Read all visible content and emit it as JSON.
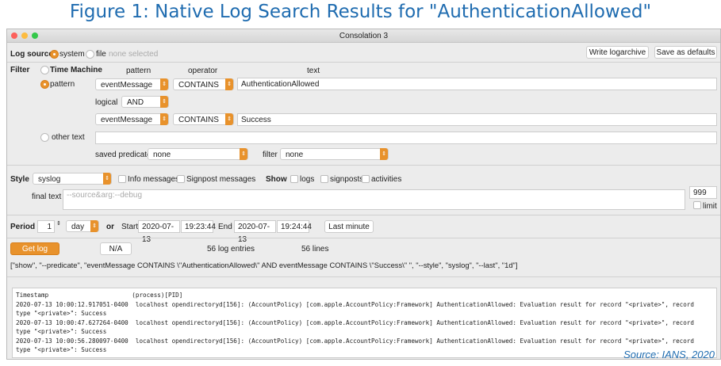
{
  "figure_title": "Figure 1: Native Log Search Results for \"AuthenticationAllowed\"",
  "window_title": "Consolation 3",
  "log_source": {
    "label": "Log source",
    "system": "system",
    "file": "file",
    "file_value": "none selected",
    "write_button": "Write logarchive",
    "save_button": "Save as defaults"
  },
  "filter": {
    "label": "Filter",
    "time_machine": "Time Machine",
    "col_pattern": "pattern",
    "col_operator": "operator",
    "col_text": "text",
    "pattern_radio": "pattern",
    "row1": {
      "field": "eventMessage",
      "operator": "CONTAINS",
      "text": "AuthenticationAllowed"
    },
    "logical_label": "logical",
    "logical": "AND",
    "row2": {
      "field": "eventMessage",
      "operator": "CONTAINS",
      "text": "Success"
    },
    "other_text": "other text",
    "saved_predicate_label": "saved predicate",
    "saved_predicate": "none",
    "filter_label": "filter",
    "filter_value": "none"
  },
  "style": {
    "label": "Style",
    "value": "syslog",
    "info": "Info messages",
    "signpost": "Signpost messages",
    "show": "Show",
    "logs": "logs",
    "signposts": "signposts",
    "activities": "activities",
    "final_text_label": "final text",
    "final_text_placeholder": "--source&arg:--debug",
    "limit_value": "999",
    "limit": "limit"
  },
  "period": {
    "label": "Period",
    "count": "1",
    "unit": "day",
    "or": "or",
    "start_label": "Start",
    "start_date": "2020-07-13",
    "start_time": "19:23:44",
    "end_label": "End",
    "end_date": "2020-07-13",
    "end_time": "19:24:44",
    "last_minute": "Last minute"
  },
  "actions": {
    "get_log": "Get log",
    "na": "N/A",
    "entries": "56 log entries",
    "lines": "56 lines"
  },
  "command": "[\"show\", \"--predicate\", \"eventMessage CONTAINS \\\"AuthenticationAllowed\\\" AND eventMessage CONTAINS \\\"Success\\\" \", \"--style\", \"syslog\", \"--last\", \"1d\"]",
  "log_lines": [
    "Timestamp                       (process)[PID]",
    "2020-07-13 10:00:12.917051-0400  localhost opendirectoryd[156]: (AccountPolicy) [com.apple.AccountPolicy:Framework] AuthenticationAllowed: Evaluation result for record \"<private>\", record",
    "type \"<private>\": Success",
    "2020-07-13 10:00:47.627264-0400  localhost opendirectoryd[156]: (AccountPolicy) [com.apple.AccountPolicy:Framework] AuthenticationAllowed: Evaluation result for record \"<private>\", record",
    "type \"<private>\": Success",
    "2020-07-13 10:00:56.280097-0400  localhost opendirectoryd[156]: (AccountPolicy) [com.apple.AccountPolicy:Framework] AuthenticationAllowed: Evaluation result for record \"<private>\", record",
    "type \"<private>\": Success"
  ],
  "source": "Source: IANS, 2020",
  "colors": {
    "accent": "#e8922c",
    "title_blue": "#1f6cb0"
  }
}
